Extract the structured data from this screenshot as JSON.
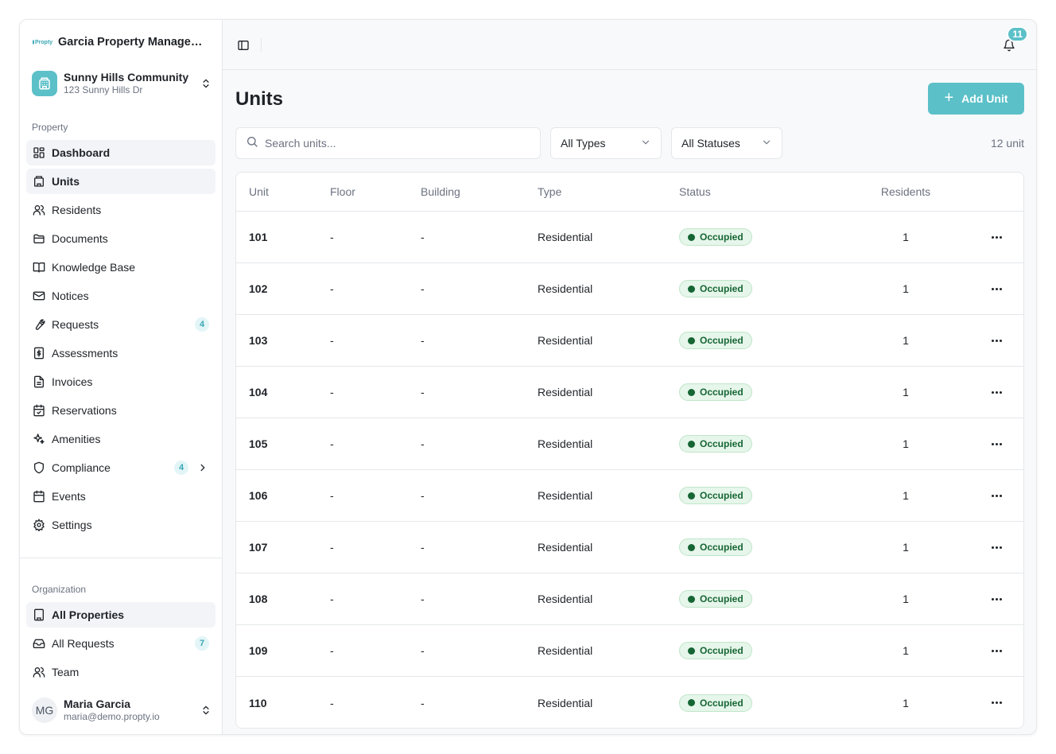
{
  "brand": {
    "logo_text": "Propty",
    "name": "Garcia Property Management"
  },
  "property": {
    "name": "Sunny Hills Community",
    "address": "123 Sunny Hills Dr"
  },
  "sidebar": {
    "property_label": "Property",
    "items": [
      {
        "label": "Dashboard",
        "icon": "dashboard-icon"
      },
      {
        "label": "Units",
        "icon": "building-icon"
      },
      {
        "label": "Residents",
        "icon": "users-icon"
      },
      {
        "label": "Documents",
        "icon": "folder-icon"
      },
      {
        "label": "Knowledge Base",
        "icon": "book-icon"
      },
      {
        "label": "Notices",
        "icon": "mail-icon"
      },
      {
        "label": "Requests",
        "icon": "wrench-icon",
        "badge": "4"
      },
      {
        "label": "Assessments",
        "icon": "dollar-icon"
      },
      {
        "label": "Invoices",
        "icon": "file-icon"
      },
      {
        "label": "Reservations",
        "icon": "calendar-check-icon"
      },
      {
        "label": "Amenities",
        "icon": "sparkles-icon"
      },
      {
        "label": "Compliance",
        "icon": "shield-icon",
        "badge": "4"
      },
      {
        "label": "Events",
        "icon": "calendar-icon"
      },
      {
        "label": "Settings",
        "icon": "gear-icon"
      }
    ],
    "org_label": "Organization",
    "org_items": [
      {
        "label": "All Properties",
        "icon": "building-list-icon"
      },
      {
        "label": "All Requests",
        "icon": "inbox-icon",
        "badge": "7"
      },
      {
        "label": "Team",
        "icon": "team-icon"
      }
    ],
    "active": "Units"
  },
  "user": {
    "initials": "MG",
    "name": "Maria Garcia",
    "email": "maria@demo.propty.io"
  },
  "topbar": {
    "notification_count": "11"
  },
  "page": {
    "title": "Units",
    "add_button": "Add Unit",
    "unit_count": "12 unit"
  },
  "filters": {
    "search_placeholder": "Search units...",
    "type_value": "All Types",
    "status_value": "All Statuses"
  },
  "table": {
    "headers": {
      "unit": "Unit",
      "floor": "Floor",
      "building": "Building",
      "type": "Type",
      "status": "Status",
      "residents": "Residents"
    },
    "rows": [
      {
        "unit": "101",
        "floor": "-",
        "building": "-",
        "type": "Residential",
        "status": "Occupied",
        "residents": "1"
      },
      {
        "unit": "102",
        "floor": "-",
        "building": "-",
        "type": "Residential",
        "status": "Occupied",
        "residents": "1"
      },
      {
        "unit": "103",
        "floor": "-",
        "building": "-",
        "type": "Residential",
        "status": "Occupied",
        "residents": "1"
      },
      {
        "unit": "104",
        "floor": "-",
        "building": "-",
        "type": "Residential",
        "status": "Occupied",
        "residents": "1"
      },
      {
        "unit": "105",
        "floor": "-",
        "building": "-",
        "type": "Residential",
        "status": "Occupied",
        "residents": "1"
      },
      {
        "unit": "106",
        "floor": "-",
        "building": "-",
        "type": "Residential",
        "status": "Occupied",
        "residents": "1"
      },
      {
        "unit": "107",
        "floor": "-",
        "building": "-",
        "type": "Residential",
        "status": "Occupied",
        "residents": "1"
      },
      {
        "unit": "108",
        "floor": "-",
        "building": "-",
        "type": "Residential",
        "status": "Occupied",
        "residents": "1"
      },
      {
        "unit": "109",
        "floor": "-",
        "building": "-",
        "type": "Residential",
        "status": "Occupied",
        "residents": "1"
      },
      {
        "unit": "110",
        "floor": "-",
        "building": "-",
        "type": "Residential",
        "status": "Occupied",
        "residents": "1"
      }
    ]
  },
  "colors": {
    "accent": "#5bc0c8",
    "status_green": "#166534",
    "status_bg": "#e6f6ea"
  }
}
